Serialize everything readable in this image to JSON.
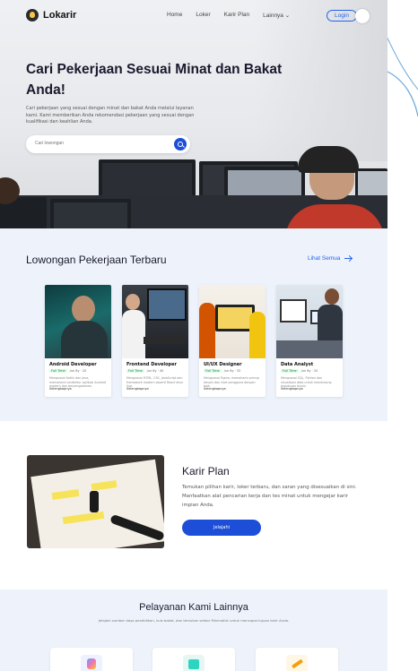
{
  "nav": {
    "brand": "Lokarir",
    "links": [
      "Home",
      "Loker",
      "Karir Plan",
      "Lainnya"
    ],
    "login_label": "Login"
  },
  "hero": {
    "title": "Cari Pekerjaan Sesuai Minat dan Bakat Anda!",
    "description": "Cari pekerjaan yang sesuai dengan minat dan bakat Anda melalui layanan kami. Kami memberikan Anda rekomendasi pekerjaan yang sesuai dengan kualifikasi dan keahlian Anda.",
    "search_placeholder": "Cari lowongan"
  },
  "jobs": {
    "title": "Lowongan Pekerjaan Terbaru",
    "see_all": "Lihat Semua",
    "cards": [
      {
        "title": "Android Developer",
        "type": "Full Time",
        "meta": "Jun 8y · 20",
        "desc": "Menguasai Kotlin dan Java, memahami arsitektur aplikasi Android modern dan berpengalaman.",
        "more": "Selengkapnya"
      },
      {
        "title": "Frontend Developer",
        "type": "Full Time",
        "meta": "Jun 8y · 40",
        "desc": "Menguasai HTML, CSS, JavaScript dan framework modern seperti React atau Vue.",
        "more": "Selengkapnya"
      },
      {
        "title": "UI/UX Designer",
        "type": "Full Time",
        "meta": "Jun 8y · 32",
        "desc": "Menguasai Figma, memahami prinsip desain dan riset pengguna dengan baik.",
        "more": "Selengkapnya"
      },
      {
        "title": "Data Analyst",
        "type": "Full Time",
        "meta": "Jun 8y · 20",
        "desc": "Menguasai SQL, Python dan visualisasi data untuk mendukung keputusan bisnis.",
        "more": "Selengkapnya"
      }
    ]
  },
  "career": {
    "title": "Karir Plan",
    "description": "Temukan pilihan karir, loker terbaru, dan saran yang disesuaikan di sini. Manfaatkan alat pencarian kerja dan tes minat untuk mengejar karir impian Anda.",
    "button": "Jelajahi"
  },
  "services": {
    "title": "Pelayanan Kami Lainnya",
    "description": "Jelajahi sumber daya pendidikan, kuis bakat, dan temukan sektor Minimalist untuk mencapai tujuan karir Anda."
  },
  "colors": {
    "accent": "#1d4ed8",
    "link": "#2563eb",
    "section_bg": "#eef3fb"
  }
}
